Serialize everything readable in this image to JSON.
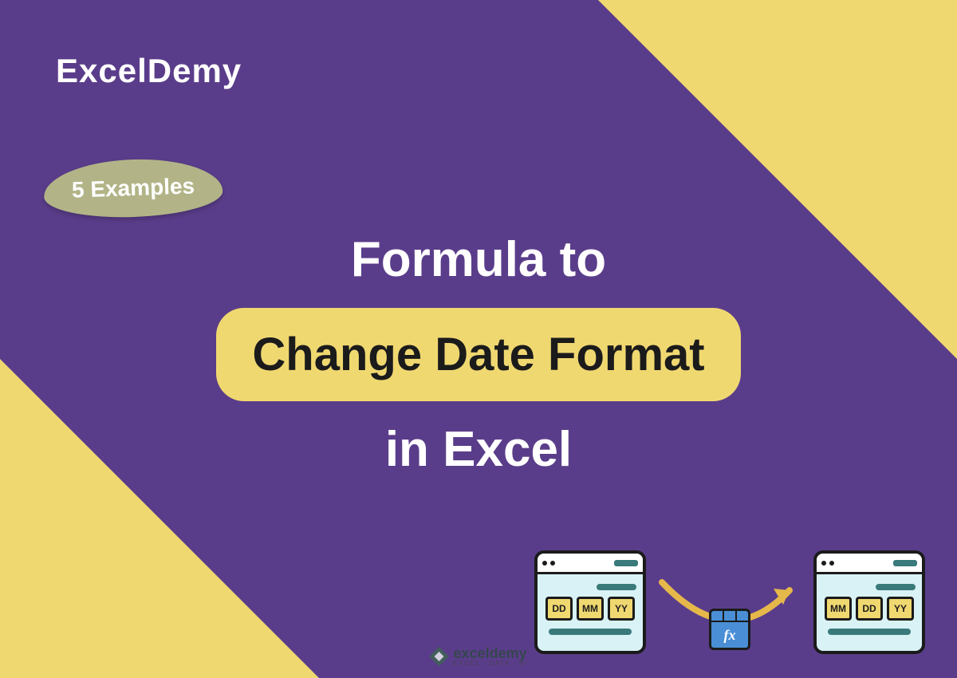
{
  "brand": "ExcelDemy",
  "badge": "5 Examples",
  "title": {
    "line1": "Formula to",
    "highlight": "Change Date Format",
    "line3": "in Excel"
  },
  "left_window": {
    "cells": [
      "DD",
      "MM",
      "YY"
    ]
  },
  "right_window": {
    "cells": [
      "MM",
      "DD",
      "YY"
    ]
  },
  "fx_label": "fx",
  "watermark": {
    "main": "exceldemy",
    "sub": "EXCEL · DATA · BI"
  }
}
